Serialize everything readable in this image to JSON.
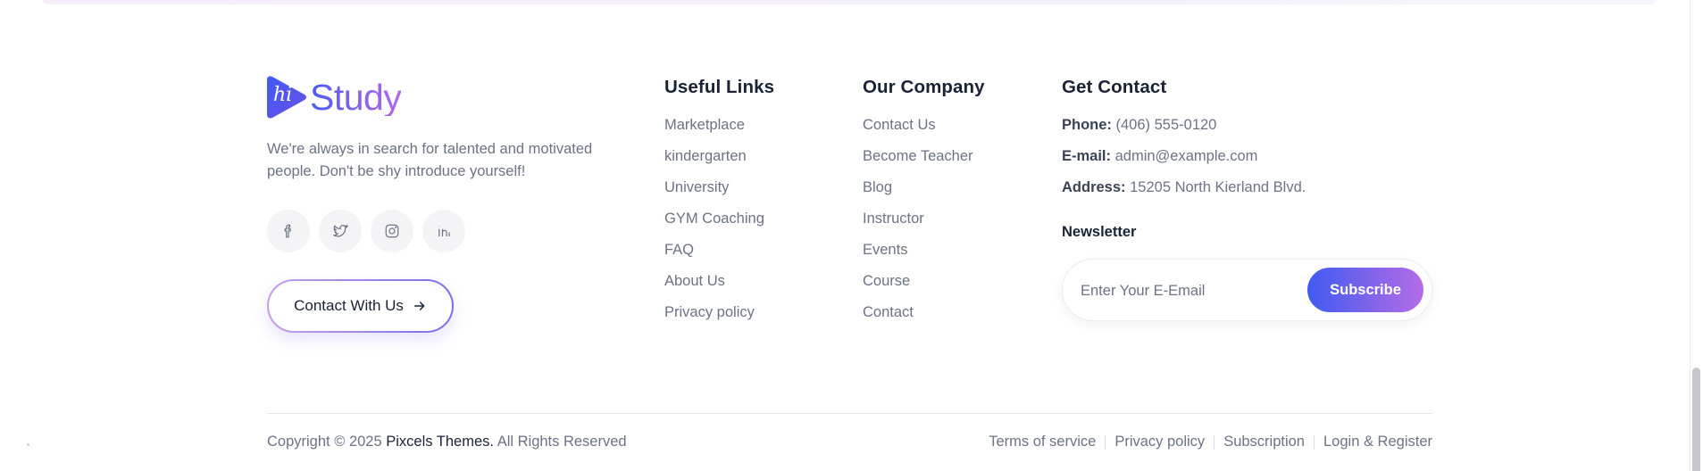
{
  "brand": {
    "logo_mark": "hi",
    "logo_text": "Study",
    "about": "We're always in search for talented and motivated people. Don't be shy introduce yourself!"
  },
  "socials": [
    {
      "icon": "facebook-icon"
    },
    {
      "icon": "twitter-icon"
    },
    {
      "icon": "instagram-icon"
    },
    {
      "icon": "linkedin-icon"
    }
  ],
  "contact_button": {
    "label": "Contact With Us",
    "icon": "arrow-right-icon"
  },
  "useful_links": {
    "title": "Useful Links",
    "items": [
      "Marketplace",
      "kindergarten",
      "University",
      "GYM Coaching",
      "FAQ",
      "About Us",
      "Privacy policy"
    ]
  },
  "our_company": {
    "title": "Our Company",
    "items": [
      "Contact Us",
      "Become Teacher",
      "Blog",
      "Instructor",
      "Events",
      "Course",
      "Contact"
    ]
  },
  "get_contact": {
    "title": "Get Contact",
    "phone_label": "Phone:",
    "phone": "(406) 555-0120",
    "email_label": "E-mail:",
    "email": "admin@example.com",
    "address_label": "Address:",
    "address": "15205 North Kierland Blvd."
  },
  "newsletter": {
    "title": "Newsletter",
    "placeholder": "Enter Your E-Email",
    "value": "",
    "button": "Subscribe"
  },
  "footer": {
    "copyright_prefix": "Copyright © 2025",
    "copyright_brand": "Pixcels Themes.",
    "copyright_suffix": "All Rights Reserved",
    "links": [
      "Terms of service",
      "Privacy policy",
      "Subscription",
      "Login & Register"
    ]
  },
  "colors": {
    "heading": "#192335",
    "body": "#6b7385",
    "accent_start": "#3f5bf1",
    "accent_end": "#b66ce6"
  }
}
